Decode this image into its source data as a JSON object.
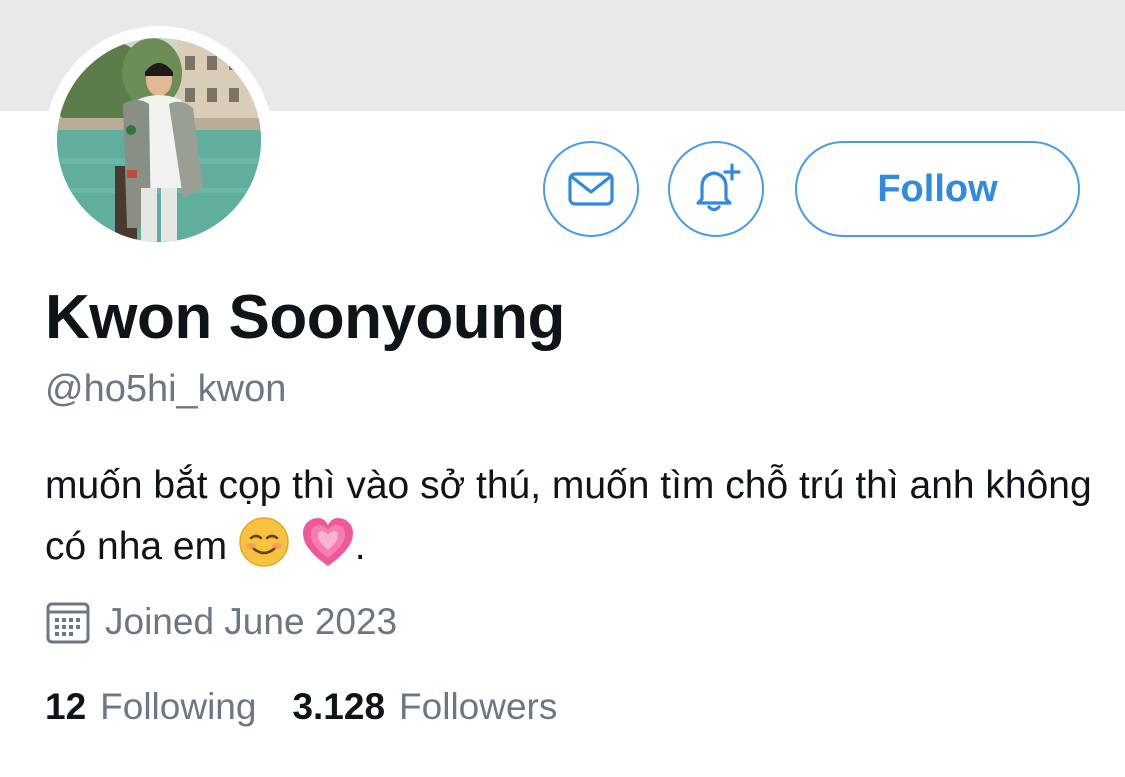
{
  "profile": {
    "display_name": "Kwon Soonyoung",
    "handle": "@ho5hi_kwon",
    "bio_text": "muốn bắt cọp thì vào sở thú, muốn tìm chỗ trú thì anh không có nha em",
    "bio_emojis": [
      "smiling-face-emoji",
      "growing-heart-emoji"
    ],
    "bio_trailing": ".",
    "joined": "Joined June 2023"
  },
  "actions": {
    "follow_label": "Follow",
    "message_icon": "envelope-icon",
    "notify_icon": "bell-plus-icon"
  },
  "stats": {
    "following_count": "12",
    "following_label": "Following",
    "followers_count": "3.128",
    "followers_label": "Followers"
  },
  "colors": {
    "accent": "#2f8ae0",
    "button_border": "#4a9be6",
    "secondary_text": "#6b7785",
    "primary_text": "#0f1419",
    "banner": "#e9e9eb"
  }
}
